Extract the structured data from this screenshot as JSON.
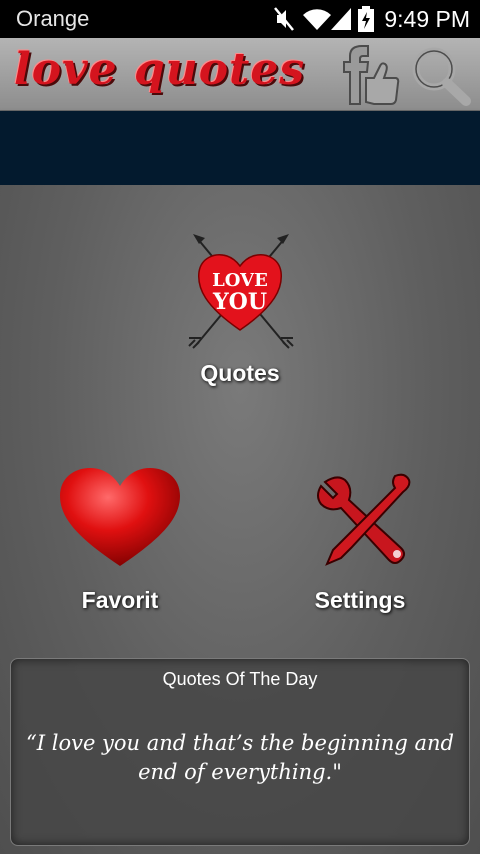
{
  "status_bar": {
    "carrier": "Orange",
    "time": "9:49 PM",
    "icons": [
      "mute-icon",
      "wifi-icon",
      "signal-icon",
      "battery-charging-icon"
    ]
  },
  "app_bar": {
    "title": "love quotes",
    "facebook_icon": "facebook-like-icon",
    "search_icon": "search-icon"
  },
  "menu": {
    "quotes": {
      "label": "Quotes",
      "icon": "love-you-heart-arrows-icon",
      "icon_text_1": "LOVE",
      "icon_text_2": "YOU"
    },
    "favorit": {
      "label": "Favorit",
      "icon": "heart-icon"
    },
    "settings": {
      "label": "Settings",
      "icon": "wrench-screwdriver-icon"
    }
  },
  "quote_of_the_day": {
    "title": "Quotes Of The Day",
    "text": "“I love you and that’s the beginning and end of everything.\""
  },
  "colors": {
    "brand_red": "#d4141e",
    "banner": "#031a2e",
    "status_bar": "#000000"
  }
}
